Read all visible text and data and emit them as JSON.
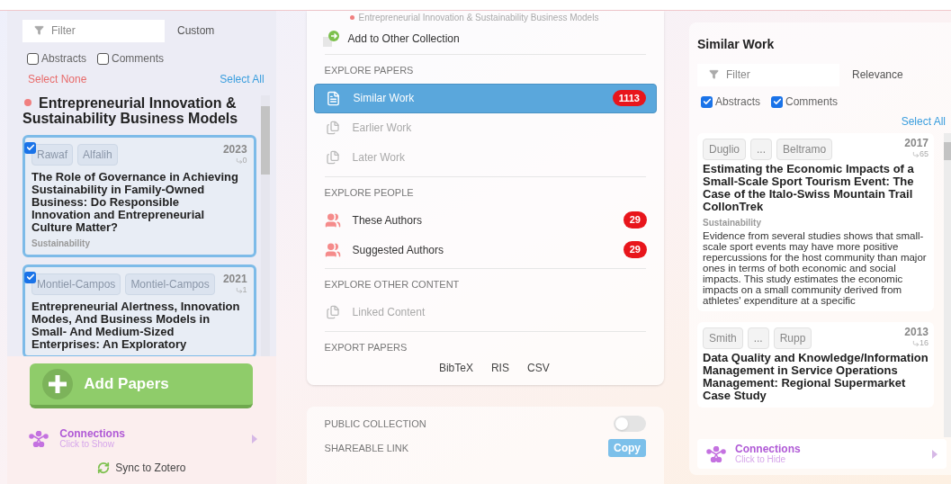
{
  "left_panel": {
    "filter": {
      "placeholder": "Filter"
    },
    "sort": "Custom",
    "toggles": [
      {
        "label": "Abstracts",
        "checked": false
      },
      {
        "label": "Comments",
        "checked": false
      }
    ],
    "select_none": "Select None",
    "select_all": "Select All",
    "collection": {
      "title": "Entrepreneurial Innovation & Sustainability Business Models",
      "color": "#f07f7f"
    },
    "papers": [
      {
        "checked": true,
        "authors": [
          "Rawaf",
          "Alfalih"
        ],
        "year": "2023",
        "citations": "0",
        "title": "The Role of Governance in Achieving Sustainability in Family-Owned Business: Do Responsible Innovation and Entrepreneurial Culture Matter?",
        "journal": "Sustainability"
      },
      {
        "checked": true,
        "authors": [
          "Montiel-Campos",
          "Montiel-Campos"
        ],
        "year": "2021",
        "citations": "1",
        "title": "Entrepreneurial Alertness, Innovation Modes, And Business Models in Small- And Medium-Sized Enterprises: An Exploratory"
      }
    ],
    "add_button": "Add Papers",
    "connections": {
      "title": "Connections",
      "subtitle": "Click to Show"
    },
    "sync": "Sync to Zotero"
  },
  "menu": {
    "current_collection": {
      "label": "Entrepreneurial Innovation & Sustainability Business Models",
      "color": "#f07f7f"
    },
    "add_to_other": "Add to Other Collection",
    "sections": [
      {
        "heading": "EXPLORE PAPERS",
        "items": [
          {
            "label": "Similar Work",
            "selected": true,
            "disabled": false,
            "badge": "1113"
          },
          {
            "label": "Earlier Work",
            "selected": false,
            "disabled": true
          },
          {
            "label": "Later Work",
            "selected": false,
            "disabled": true
          }
        ]
      },
      {
        "heading": "EXPLORE PEOPLE",
        "items": [
          {
            "label": "These Authors",
            "selected": false,
            "disabled": false,
            "badge": "29"
          },
          {
            "label": "Suggested Authors",
            "selected": false,
            "disabled": false,
            "badge": "29"
          }
        ]
      },
      {
        "heading": "EXPLORE OTHER CONTENT",
        "items": [
          {
            "label": "Linked Content",
            "selected": false,
            "disabled": true
          }
        ]
      },
      {
        "heading": "EXPORT PAPERS",
        "formats": [
          "BibTeX",
          "RIS",
          "CSV"
        ]
      }
    ],
    "sharing": {
      "public_label": "PUBLIC COLLECTION",
      "public_on": false,
      "link_label": "SHAREABLE LINK",
      "copy": "Copy"
    }
  },
  "similar_panel": {
    "title": "Similar Work",
    "filter": {
      "placeholder": "Filter"
    },
    "sort": "Relevance",
    "toggles": [
      {
        "label": "Abstracts",
        "checked": true
      },
      {
        "label": "Comments",
        "checked": true
      }
    ],
    "select_all": "Select All",
    "papers": [
      {
        "authors": [
          "Duglio",
          "...",
          "Beltramo"
        ],
        "year": "2017",
        "citations": "65",
        "title": "Estimating the Economic Impacts of a Small-Scale Sport Tourism Event: The Case of the Italo-Swiss Mountain Trail CollonTrek",
        "journal": "Sustainability",
        "abstract": "Evidence from several studies shows that small-scale sport events may have more positive repercussions for the host community than major ones in terms of both economic and social impacts. This study estimates the economic impacts on a small community derived from athletes' expenditure at a specific"
      },
      {
        "authors": [
          "Smith",
          "...",
          "Rupp"
        ],
        "year": "2013",
        "citations": "16",
        "title": "Data Quality and Knowledge/Information Management in Service Operations Management: Regional Supermarket Case Study"
      }
    ],
    "connections": {
      "title": "Connections",
      "subtitle": "Click to Hide"
    }
  }
}
